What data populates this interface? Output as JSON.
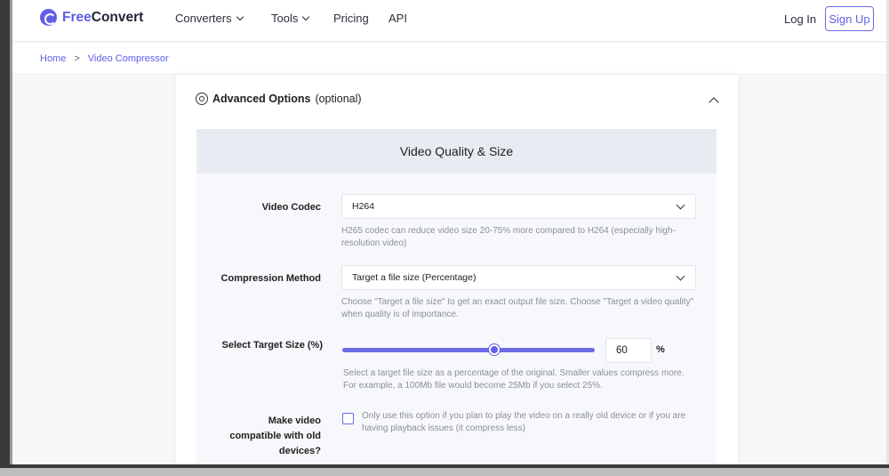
{
  "brand": {
    "name_part1": "Free",
    "name_part2": "Convert",
    "accent": "#5f5fe8"
  },
  "nav": {
    "converters": "Converters",
    "tools": "Tools",
    "pricing": "Pricing",
    "api": "API",
    "login": "Log In",
    "signup": "Sign Up"
  },
  "breadcrumb": {
    "home": "Home",
    "separator": ">",
    "current": "Video Compressor"
  },
  "advanced": {
    "title": "Advanced Options",
    "suffix": "(optional)"
  },
  "section": {
    "title": "Video Quality & Size"
  },
  "codec": {
    "label": "Video Codec",
    "value": "H264",
    "hint": "H265 codec can reduce video size 20-75% more compared to H264 (especially high-resolution video)"
  },
  "compression": {
    "label": "Compression Method",
    "value": "Target a file size (Percentage)",
    "hint": "Choose \"Target a file size\" to get an exact output file size. Choose \"Target a video quality\" when quality is of importance."
  },
  "target": {
    "label": "Select Target Size (%)",
    "value": "60",
    "unit": "%",
    "slider_fraction": 0.6,
    "hint": "Select a target file size as a percentage of the original. Smaller values compress more. For example, a 100Mb file would become 25Mb if you select 25%."
  },
  "compat": {
    "label": "Make video compatible with old devices?",
    "checked": false,
    "hint": "Only use this option if you plan to play the video on a really old device or if you are having playback issues (it compress less)"
  }
}
